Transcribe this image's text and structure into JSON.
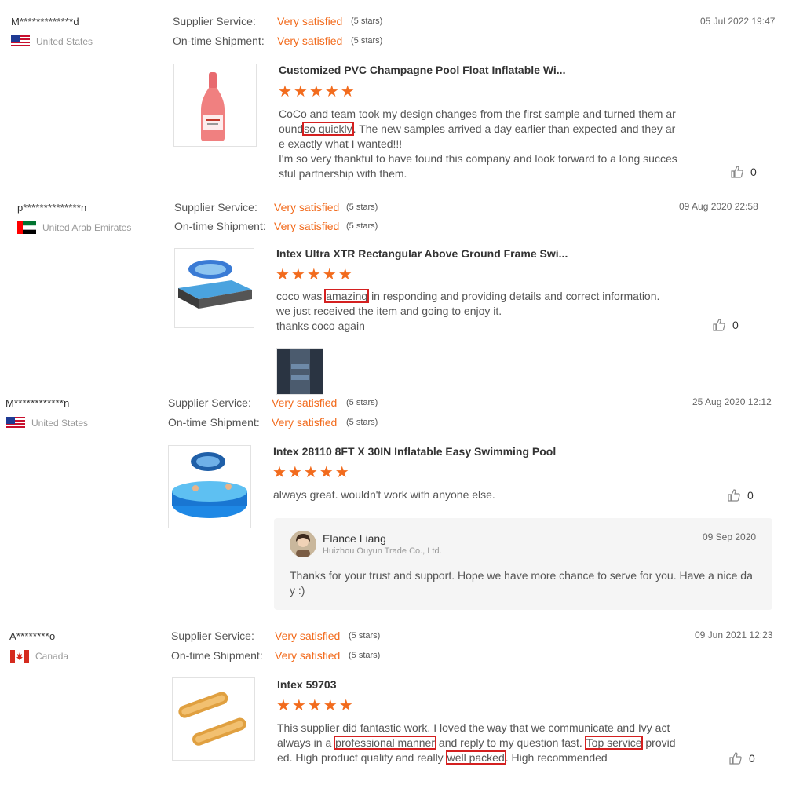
{
  "reviews": [
    {
      "user": "M*************d",
      "country": "United States",
      "supplier_label": "Supplier Service:",
      "supplier_value": "Very satisfied",
      "supplier_stars": "(5 stars)",
      "shipment_label": "On-time Shipment:",
      "shipment_value": "Very satisfied",
      "shipment_stars": "(5 stars)",
      "date": "05 Jul 2022 19:47",
      "product_title": "Customized PVC Champagne Pool Float Inflatable Wi...",
      "rating": "★★★★★",
      "text_a": "CoCo and team took my design changes from the first sample and turned them around",
      "hl_1": "so quickly",
      "text_b": ". The new samples arrived a day earlier than expected and they are exactly what I wanted!!!",
      "text_c": "I'm so very thankful to have found this company and look forward to a long successful partnership with them.",
      "likes": "0"
    },
    {
      "user": "p**************n",
      "country": "United Arab Emirates",
      "supplier_label": "Supplier Service:",
      "supplier_value": "Very satisfied",
      "supplier_stars": "(5 stars)",
      "shipment_label": "On-time Shipment:",
      "shipment_value": "Very satisfied",
      "shipment_stars": "(5 stars)",
      "date": "09 Aug 2020 22:58",
      "product_title": "Intex Ultra XTR Rectangular Above Ground Frame Swi...",
      "rating": "★★★★★",
      "text_a": "coco was",
      "hl_1": "amazing",
      "text_b": "in responding and providing details and correct information. we just received the item and going to enjoy it.",
      "text_c": "thanks coco again",
      "likes": "0"
    },
    {
      "user": "M************n",
      "country": "United States",
      "supplier_label": "Supplier Service:",
      "supplier_value": "Very satisfied",
      "supplier_stars": "(5 stars)",
      "shipment_label": "On-time Shipment:",
      "shipment_value": "Very satisfied",
      "shipment_stars": "(5 stars)",
      "date": "25 Aug 2020 12:12",
      "product_title": "Intex 28110 8FT X 30IN Inflatable Easy Swimming Pool",
      "rating": "★★★★★",
      "text_a": "always great. wouldn't work with anyone else.",
      "likes": "0",
      "reply": {
        "name": "Elance Liang",
        "company": "Huizhou Ouyun Trade Co., Ltd.",
        "date": "09 Sep 2020",
        "text": "Thanks for your trust and support. Hope we have more chance to serve for you. Have a nice day :)"
      }
    },
    {
      "user": "A********o",
      "country": "Canada",
      "supplier_label": "Supplier Service:",
      "supplier_value": "Very satisfied",
      "supplier_stars": "(5 stars)",
      "shipment_label": "On-time Shipment:",
      "shipment_value": "Very satisfied",
      "shipment_stars": "(5 stars)",
      "date": "09 Jun 2021 12:23",
      "product_title": "Intex 59703",
      "rating": "★★★★★",
      "text_a": "This supplier did fantastic work. I loved the way that we communicate and Ivy act always in a",
      "hl_1": "professional manner",
      "text_b": "and reply to my question fast.",
      "hl_2": "Top service",
      "text_c": "provided. High product quality and really",
      "hl_3": "well packed",
      "text_d": ". High recommended",
      "likes": "0"
    }
  ],
  "colors": {
    "accent": "#f26b1d",
    "highlight_box": "#d42020"
  },
  "icons": {
    "like": "thumbs-up-icon"
  }
}
